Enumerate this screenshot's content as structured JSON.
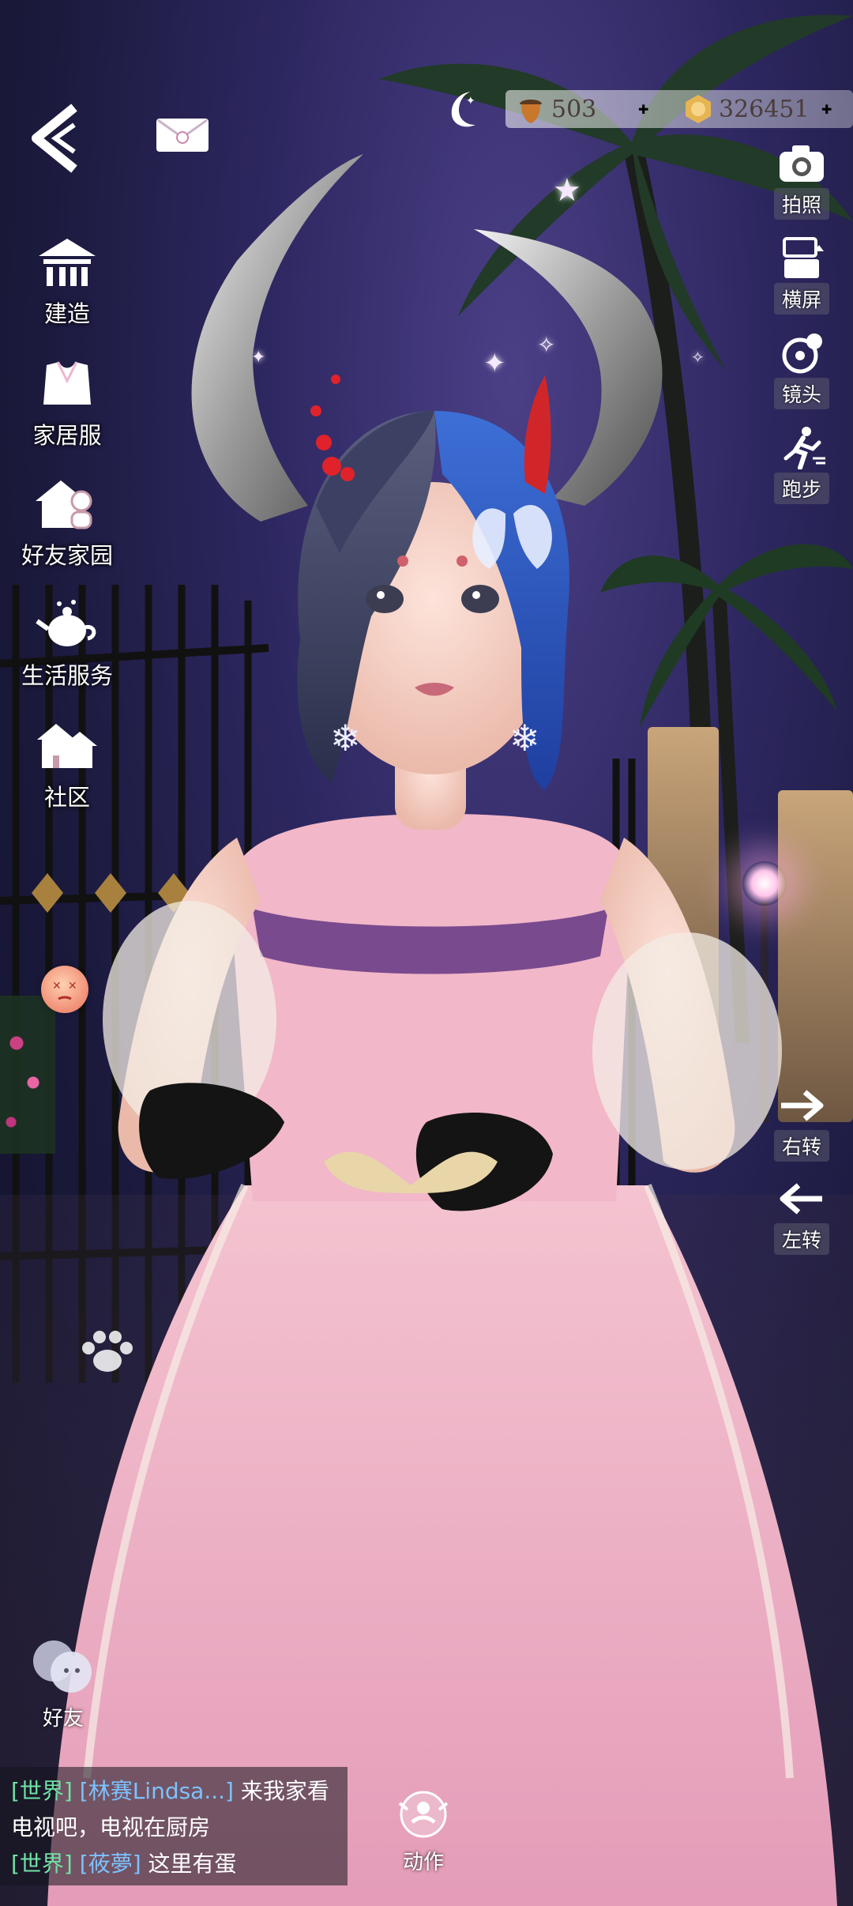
{
  "currency": {
    "acorn": {
      "icon": "acorn-icon",
      "value": "503"
    },
    "coin": {
      "icon": "coin-icon",
      "value": "326451"
    }
  },
  "left_menu": [
    {
      "icon": "house-build-icon",
      "label": "建造"
    },
    {
      "icon": "clothes-icon",
      "label": "家居服"
    },
    {
      "icon": "friend-home-icon",
      "label": "好友家园"
    },
    {
      "icon": "teapot-icon",
      "label": "生活服务"
    },
    {
      "icon": "community-icon",
      "label": "社区"
    }
  ],
  "right_menu": [
    {
      "icon": "camera-icon",
      "label": "拍照"
    },
    {
      "icon": "rotate-screen-icon",
      "label": "横屏"
    },
    {
      "icon": "lens-icon",
      "label": "镜头"
    },
    {
      "icon": "run-icon",
      "label": "跑步"
    },
    {
      "icon": "arrow-right-icon",
      "label": "右转"
    },
    {
      "icon": "arrow-left-icon",
      "label": "左转"
    }
  ],
  "bottom": {
    "friends_label": "好友",
    "action_label": "动作"
  },
  "chat": [
    {
      "channel": "[世界]",
      "user": "[林赛Lindsa...]",
      "text": "来我家看"
    },
    {
      "channel": "",
      "user": "",
      "text": "电视吧，电视在厨房"
    },
    {
      "channel": "[世界]",
      "user": "[莜夢]",
      "text": "这里有蛋"
    }
  ],
  "colors": {
    "chat_channel": "#6fe3a6",
    "chat_user": "#7cc2ff",
    "sky": "#2d2760"
  }
}
